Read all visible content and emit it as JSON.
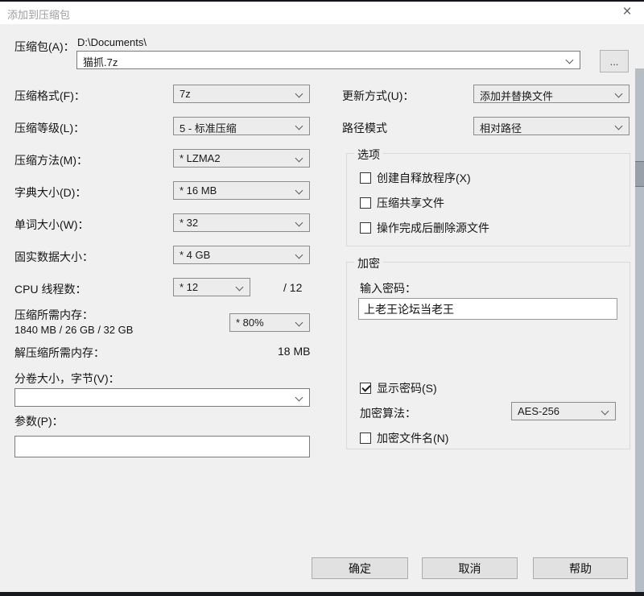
{
  "window": {
    "title": "添加到压缩包",
    "close_glyph": "×"
  },
  "archive": {
    "label": "压缩包(A)：",
    "dir_path": "D:\\Documents\\",
    "name_value": "猫抓.7z",
    "browse_label": "..."
  },
  "left_fields": [
    {
      "label": "压缩格式(F)：",
      "value": "7z"
    },
    {
      "label": "压缩等级(L)：",
      "value": "5 - 标准压缩"
    },
    {
      "label": "压缩方法(M)：",
      "value": "* LZMA2"
    },
    {
      "label": "字典大小(D)：",
      "value": "* 16 MB"
    },
    {
      "label": "单词大小(W)：",
      "value": "* 32"
    },
    {
      "label": "固实数据大小：",
      "value": "* 4 GB"
    }
  ],
  "cpu": {
    "label": "CPU 线程数：",
    "value": "* 12",
    "suffix": "/ 12"
  },
  "memory": {
    "compress_label": "压缩所需内存：",
    "compress_detail": "1840 MB / 26 GB / 32 GB",
    "percent_value": "* 80%",
    "decompress_label": "解压缩所需内存：",
    "decompress_value": "18 MB"
  },
  "volume": {
    "label": "分卷大小，字节(V)：",
    "value": ""
  },
  "params": {
    "label": "参数(P)：",
    "value": ""
  },
  "right_fields": [
    {
      "label": "更新方式(U)：",
      "value": "添加并替换文件"
    },
    {
      "label": "路径模式",
      "value": "相对路径"
    }
  ],
  "options_group": {
    "title": "选项",
    "checkboxes": [
      {
        "label": "创建自释放程序(X)",
        "checked": false
      },
      {
        "label": "压缩共享文件",
        "checked": false
      },
      {
        "label": "操作完成后删除源文件",
        "checked": false
      }
    ]
  },
  "encryption_group": {
    "title": "加密",
    "password_label": "输入密码：",
    "password_value": "上老王论坛当老王",
    "show_password": {
      "label": "显示密码(S)",
      "checked": true
    },
    "method_label": "加密算法：",
    "method_value": "AES-256",
    "encrypt_names": {
      "label": "加密文件名(N)",
      "checked": false
    }
  },
  "buttons": {
    "ok": "确定",
    "cancel": "取消",
    "help": "帮助"
  },
  "colors": {
    "dialog_bg": "#f0f0f0",
    "titlebar_bg": "#ffffff",
    "strip": "#b6bdc5"
  }
}
